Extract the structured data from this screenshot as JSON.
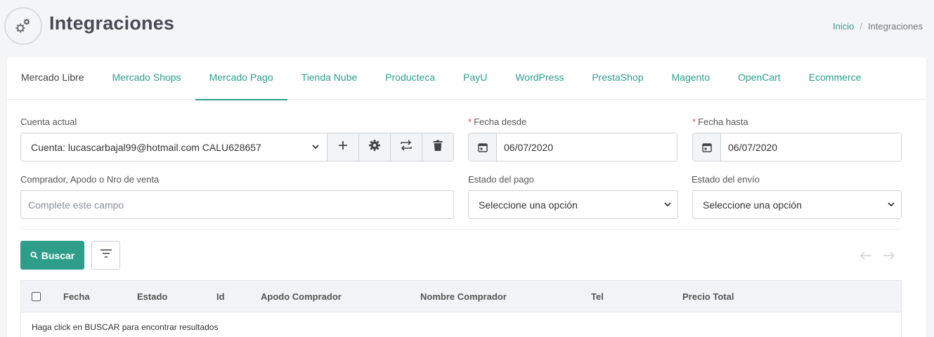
{
  "header": {
    "title": "Integraciones",
    "breadcrumb": {
      "home": "Inicio",
      "current": "Integraciones"
    }
  },
  "tabs": [
    {
      "label": "Mercado Libre"
    },
    {
      "label": "Mercado Shops"
    },
    {
      "label": "Mercado Pago"
    },
    {
      "label": "Tienda Nube"
    },
    {
      "label": "Producteca"
    },
    {
      "label": "PayU"
    },
    {
      "label": "WordPress"
    },
    {
      "label": "PrestaShop"
    },
    {
      "label": "Magento"
    },
    {
      "label": "OpenCart"
    },
    {
      "label": "Ecommerce"
    }
  ],
  "active_tab": "Mercado Pago",
  "form": {
    "account_label": "Cuenta actual",
    "account_value": "Cuenta: lucascarbajal99@hotmail.com CALU628657",
    "date_from_label": "Fecha desde",
    "date_from_value": "06/07/2020",
    "date_to_label": "Fecha hasta",
    "date_to_value": "06/07/2020",
    "search_label": "Comprador, Apodo o Nro de venta",
    "search_placeholder": "Complete este campo",
    "payment_status_label": "Estado del pago",
    "payment_status_value": "Seleccione una opción",
    "shipping_status_label": "Estado del envío",
    "shipping_status_value": "Seleccione una opción",
    "required_mark": "*"
  },
  "actions": {
    "search_label": "Buscar"
  },
  "table": {
    "columns": [
      "Fecha",
      "Estado",
      "Id",
      "Apodo Comprador",
      "Nombre Comprador",
      "Tel",
      "Precio Total"
    ],
    "empty_message": "Haga click en BUSCAR para encontrar resultados"
  },
  "colors": {
    "accent": "#2e9d8a",
    "required": "#e04b4b"
  },
  "icons": [
    "gears-icon",
    "plus-icon",
    "gear-icon",
    "swap-icon",
    "trash-icon",
    "calendar-icon",
    "chevron-down-icon",
    "search-icon",
    "filter-icon",
    "arrow-left-icon",
    "arrow-right-icon"
  ]
}
